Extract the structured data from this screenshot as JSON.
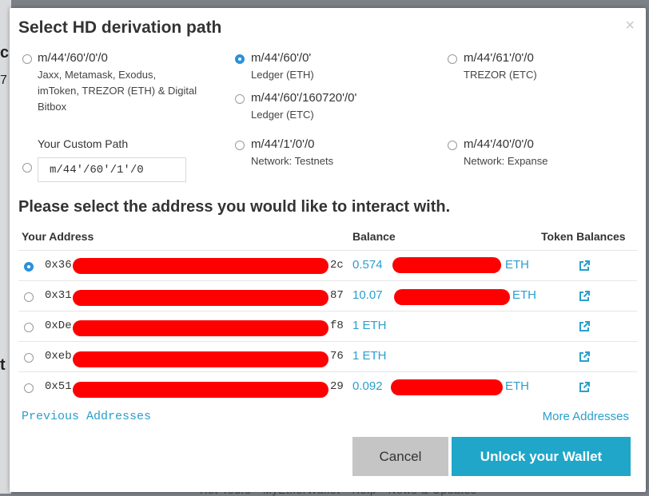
{
  "background": {
    "left_chars": [
      "c",
      "7",
      "t"
    ],
    "bottom_text": "Hot Tours · MyEtherWallet · Help · News & Updates"
  },
  "modal": {
    "title": "Select HD derivation path",
    "close_symbol": "×"
  },
  "paths": [
    {
      "label": "m/44'/60'/0'/0",
      "sub": "Jaxx, Metamask, Exodus, imToken, TREZOR (ETH) & Digital Bitbox",
      "selected": false
    },
    {
      "label": "m/44'/60'/0'",
      "sub": "Ledger (ETH)",
      "selected": true
    },
    {
      "label": "m/44'/61'/0'/0",
      "sub": "TREZOR (ETC)",
      "selected": false
    },
    {
      "label": "m/44'/60'/160720'/0'",
      "sub": "Ledger (ETC)",
      "selected": false
    },
    {
      "label": "m/44'/1'/0'/0",
      "sub": "Network: Testnets",
      "selected": false
    },
    {
      "label": "m/44'/40'/0'/0",
      "sub": "Network: Expanse",
      "selected": false
    }
  ],
  "custom_path": {
    "label": "Your Custom Path",
    "value": "m/44'/60'/1'/0",
    "selected": false
  },
  "address_section": {
    "heading": "Please select the address you would like to interact with.",
    "columns": {
      "address": "Your Address",
      "balance": "Balance",
      "tokens": "Token Balances"
    },
    "rows": [
      {
        "addr_start": "0x36",
        "addr_end": "2c",
        "bal_start": "0.574",
        "bal_unit": "ETH",
        "selected": true
      },
      {
        "addr_start": "0x31",
        "addr_end": "87",
        "bal_start": "10.07",
        "bal_unit": "ETH",
        "selected": false
      },
      {
        "addr_start": "0xDe",
        "addr_end": "f8",
        "bal_start": "1 ETH",
        "bal_unit": "",
        "selected": false
      },
      {
        "addr_start": "0xeb",
        "addr_end": "76",
        "bal_start": "1 ETH",
        "bal_unit": "",
        "selected": false
      },
      {
        "addr_start": "0x51",
        "addr_end": "29",
        "bal_start": "0.092",
        "bal_unit": "ETH",
        "selected": false
      }
    ]
  },
  "links": {
    "previous": "Previous Addresses",
    "more": "More Addresses"
  },
  "buttons": {
    "cancel": "Cancel",
    "unlock": "Unlock your Wallet"
  },
  "colors": {
    "accent": "#2a9fcd",
    "unlock_bg": "#1fa6c9",
    "radio_checked": "#2a90dc",
    "redaction": "#ff0000"
  }
}
